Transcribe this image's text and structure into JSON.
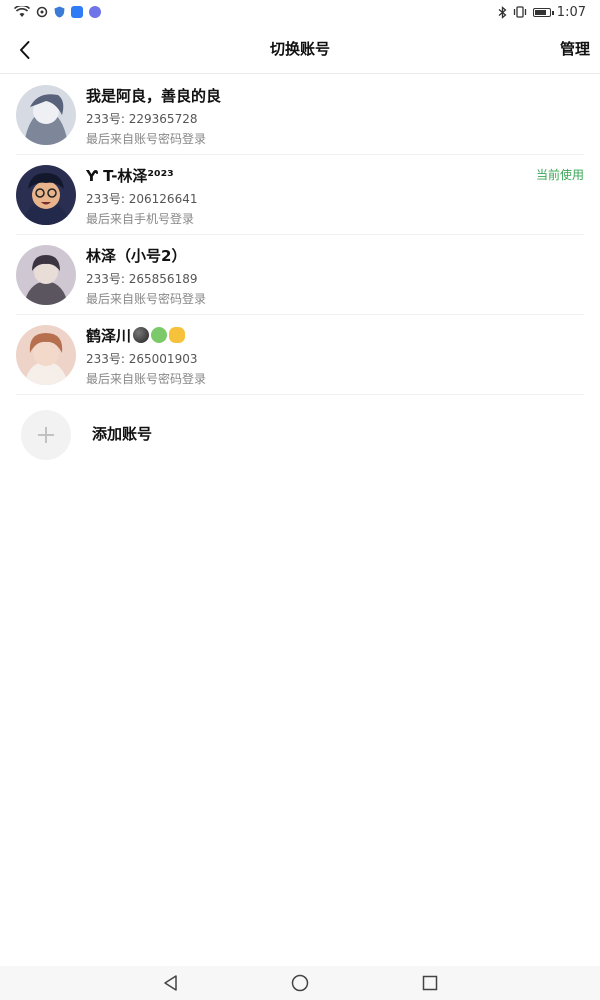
{
  "status": {
    "time": "1:07",
    "icons": [
      "wifi-icon",
      "sync-icon",
      "shield-icon",
      "app-icon",
      "app-icon"
    ],
    "right_icons": [
      "bluetooth-icon",
      "vibrate-icon",
      "battery-icon"
    ],
    "battery_level": 0.7
  },
  "header": {
    "title": "切换账号",
    "manage_label": "管理",
    "back_icon": "chevron-left-icon"
  },
  "accounts": [
    {
      "name": "我是阿良，善良的良",
      "uid": "233号: 229365728",
      "login": "最后来自账号密码登录",
      "current": false,
      "avatar_colors": [
        "#c9cfd8",
        "#6d7687"
      ]
    },
    {
      "name": "Ƴ T-林泽²⁰²³",
      "uid": "233号: 206126641",
      "login": "最后来自手机号登录",
      "current": true,
      "avatar_colors": [
        "#1d2340",
        "#d9a57c"
      ]
    },
    {
      "name": "林泽（小号2）",
      "uid": "233号: 265856189",
      "login": "最后来自账号密码登录",
      "current": false,
      "avatar_colors": [
        "#c6bfc9",
        "#3d3940"
      ]
    },
    {
      "name": "鹤泽川",
      "uid": "233号: 265001903",
      "login": "最后来自账号密码登录",
      "current": false,
      "avatar_colors": [
        "#e8c4b8",
        "#b06a4e"
      ],
      "emojis": [
        "dark-ball-emoji-icon",
        "frog-emoji-icon",
        "fist-emoji-icon"
      ]
    }
  ],
  "current_badge": "当前使用",
  "add_account_label": "添加账号",
  "colors": {
    "accent_green": "#3aa757",
    "text_primary": "#111111",
    "text_secondary": "#888888",
    "divider": "#f0f0f0"
  },
  "navbar": {
    "icons": [
      "back-triangle-icon",
      "home-circle-icon",
      "recents-square-icon"
    ]
  }
}
